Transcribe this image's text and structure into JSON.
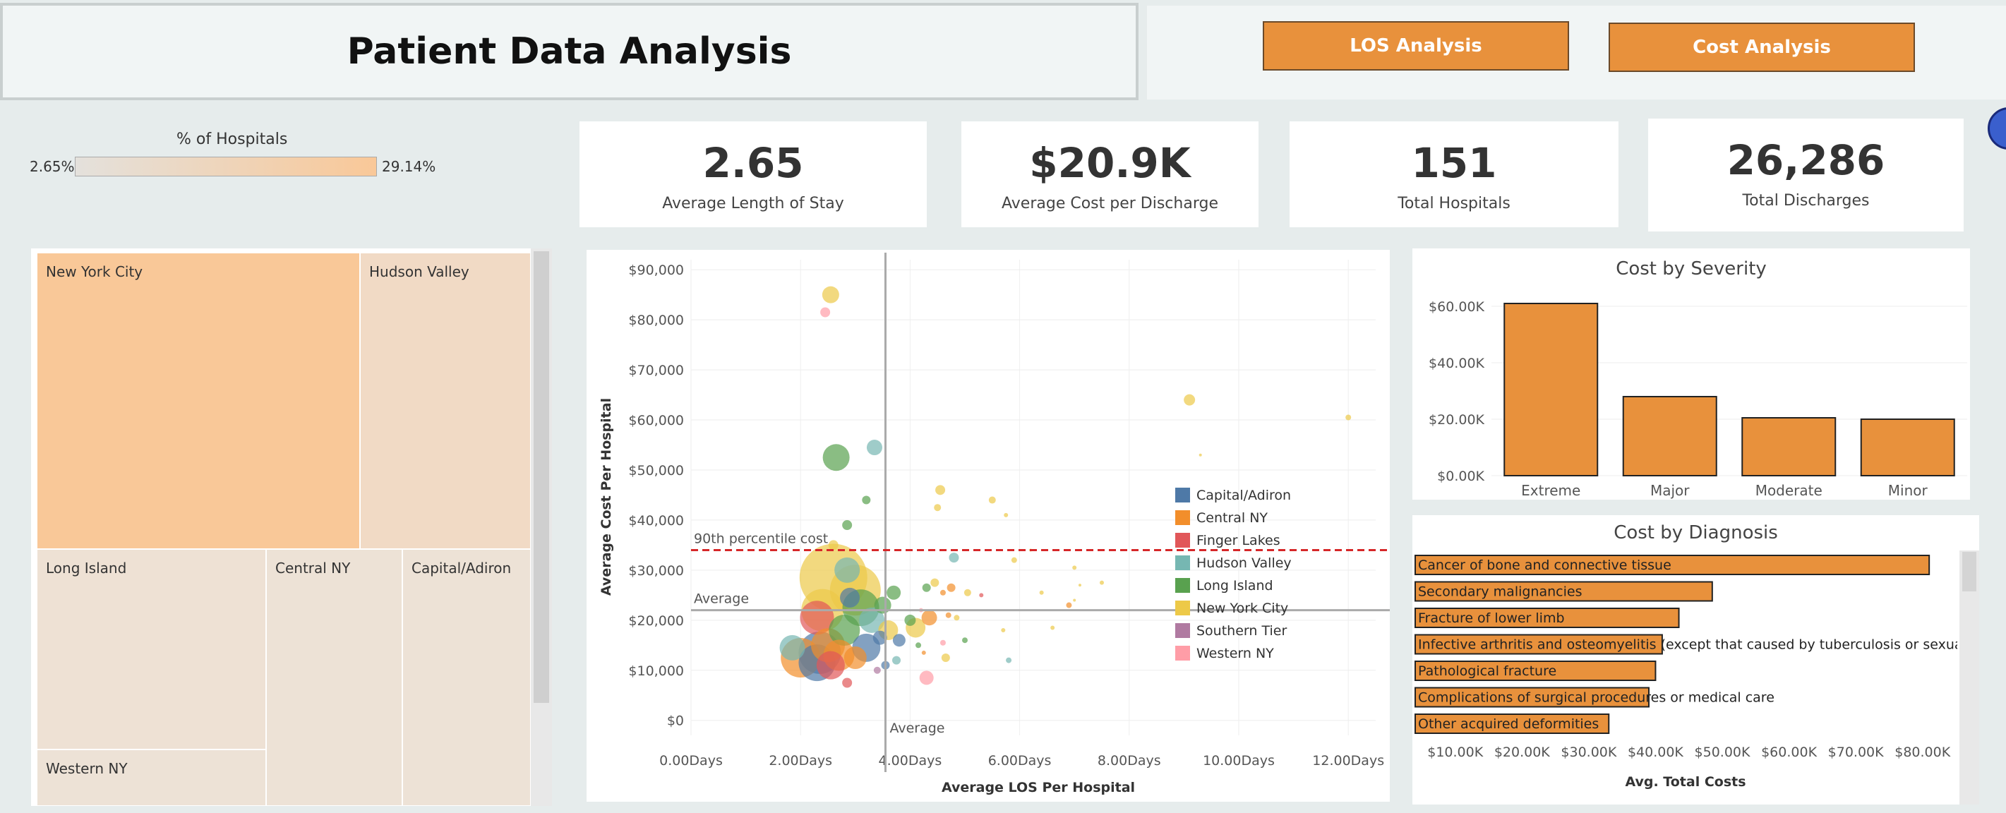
{
  "header": {
    "title": "Patient Data Analysis"
  },
  "nav": {
    "los_button": "LOS Analysis",
    "cost_button": "Cost Analysis"
  },
  "color_legend": {
    "title": "% of Hospitals",
    "min": "2.65%",
    "max": "29.14%"
  },
  "kpis": [
    {
      "value": "2.65",
      "label": "Average Length of Stay"
    },
    {
      "value": "$20.9K",
      "label": "Average Cost per Discharge"
    },
    {
      "value": "151",
      "label": "Total Hospitals"
    },
    {
      "value": "26,286",
      "label": "Total Discharges"
    }
  ],
  "colors": {
    "accent": "#e8913c",
    "background": "#e6ecec",
    "ref_line": "#d62728"
  },
  "chart_data": [
    {
      "type": "treemap",
      "title": "",
      "items": [
        {
          "name": "New York City",
          "color": "#f9c898"
        },
        {
          "name": "Hudson Valley",
          "color": "#f1dac5"
        },
        {
          "name": "Long Island",
          "color": "#eee1d4"
        },
        {
          "name": "Central NY",
          "color": "#ede2d6"
        },
        {
          "name": "Capital/Adiron",
          "color": "#ede2d6"
        },
        {
          "name": "Western NY",
          "color": "#ede2d6"
        }
      ]
    },
    {
      "type": "scatter",
      "title": "",
      "xlabel": "Average LOS Per Hospital",
      "ylabel": "Average Cost Per Hospital",
      "xlim": [
        0,
        12.5
      ],
      "ylim": [
        -3000,
        92000
      ],
      "xticks": [
        "0.00Days",
        "2.00Days",
        "4.00Days",
        "6.00Days",
        "8.00Days",
        "10.00Days",
        "12.00Days"
      ],
      "yticks": [
        "$0",
        "$10,000",
        "$20,000",
        "$30,000",
        "$40,000",
        "$50,000",
        "$60,000",
        "$70,000",
        "$80,000",
        "$90,000"
      ],
      "reference_lines": [
        {
          "label": "Average",
          "axis": "x",
          "value": 3.55
        },
        {
          "label": "Average",
          "axis": "y",
          "value": 22000
        },
        {
          "label": "90th percentile cost",
          "axis": "y",
          "value": 34000
        }
      ],
      "legend": [
        {
          "name": "Capital/Adiron",
          "color": "#4e79a7"
        },
        {
          "name": "Central NY",
          "color": "#f28e2b"
        },
        {
          "name": "Finger Lakes",
          "color": "#e15759"
        },
        {
          "name": "Hudson Valley",
          "color": "#76b7b2"
        },
        {
          "name": "Long Island",
          "color": "#59a14f"
        },
        {
          "name": "New York City",
          "color": "#edc948"
        },
        {
          "name": "Southern Tier",
          "color": "#b07aa1"
        },
        {
          "name": "Western NY",
          "color": "#ff9da7"
        }
      ],
      "points": [
        {
          "x": 2.55,
          "y": 85000,
          "s": 12,
          "c": "New York City"
        },
        {
          "x": 2.45,
          "y": 81500,
          "s": 7,
          "c": "Western NY"
        },
        {
          "x": 9.1,
          "y": 64000,
          "s": 8,
          "c": "New York City"
        },
        {
          "x": 12.0,
          "y": 60500,
          "s": 4,
          "c": "New York City"
        },
        {
          "x": 9.3,
          "y": 53000,
          "s": 2,
          "c": "New York City"
        },
        {
          "x": 2.65,
          "y": 52500,
          "s": 19,
          "c": "Long Island"
        },
        {
          "x": 3.35,
          "y": 54500,
          "s": 11,
          "c": "Hudson Valley"
        },
        {
          "x": 3.2,
          "y": 44000,
          "s": 6,
          "c": "Long Island"
        },
        {
          "x": 2.85,
          "y": 39000,
          "s": 7,
          "c": "Long Island"
        },
        {
          "x": 4.55,
          "y": 46000,
          "s": 7,
          "c": "New York City"
        },
        {
          "x": 4.5,
          "y": 42500,
          "s": 5,
          "c": "New York City"
        },
        {
          "x": 5.5,
          "y": 44000,
          "s": 5,
          "c": "New York City"
        },
        {
          "x": 5.75,
          "y": 41000,
          "s": 3,
          "c": "New York City"
        },
        {
          "x": 2.6,
          "y": 35000,
          "s": 7,
          "c": "New York City"
        },
        {
          "x": 4.8,
          "y": 32500,
          "s": 7,
          "c": "Hudson Valley"
        },
        {
          "x": 5.9,
          "y": 32000,
          "s": 4,
          "c": "New York City"
        },
        {
          "x": 7.0,
          "y": 30500,
          "s": 3,
          "c": "New York City"
        },
        {
          "x": 2.6,
          "y": 28500,
          "s": 48,
          "c": "New York City"
        },
        {
          "x": 3.0,
          "y": 26000,
          "s": 36,
          "c": "New York City"
        },
        {
          "x": 2.4,
          "y": 22000,
          "s": 30,
          "c": "New York City"
        },
        {
          "x": 2.85,
          "y": 30000,
          "s": 18,
          "c": "Hudson Valley"
        },
        {
          "x": 2.3,
          "y": 20500,
          "s": 24,
          "c": "Finger Lakes"
        },
        {
          "x": 3.1,
          "y": 22500,
          "s": 26,
          "c": "Long Island"
        },
        {
          "x": 2.8,
          "y": 18000,
          "s": 22,
          "c": "Long Island"
        },
        {
          "x": 3.3,
          "y": 20000,
          "s": 18,
          "c": "Hudson Valley"
        },
        {
          "x": 2.9,
          "y": 24500,
          "s": 14,
          "c": "Capital/Adiron"
        },
        {
          "x": 3.5,
          "y": 23000,
          "s": 12,
          "c": "Long Island"
        },
        {
          "x": 3.6,
          "y": 18000,
          "s": 14,
          "c": "New York City"
        },
        {
          "x": 3.7,
          "y": 25500,
          "s": 10,
          "c": "Long Island"
        },
        {
          "x": 2.5,
          "y": 15000,
          "s": 24,
          "c": "Central NY"
        },
        {
          "x": 2.7,
          "y": 13000,
          "s": 22,
          "c": "Central NY"
        },
        {
          "x": 2.35,
          "y": 13500,
          "s": 30,
          "c": "Capital/Adiron"
        },
        {
          "x": 2.0,
          "y": 12500,
          "s": 28,
          "c": "Central NY"
        },
        {
          "x": 2.3,
          "y": 11500,
          "s": 26,
          "c": "Capital/Adiron"
        },
        {
          "x": 2.55,
          "y": 11000,
          "s": 20,
          "c": "Finger Lakes"
        },
        {
          "x": 1.85,
          "y": 14500,
          "s": 18,
          "c": "Hudson Valley"
        },
        {
          "x": 3.2,
          "y": 14500,
          "s": 20,
          "c": "Capital/Adiron"
        },
        {
          "x": 3.0,
          "y": 12500,
          "s": 16,
          "c": "Central NY"
        },
        {
          "x": 3.45,
          "y": 16500,
          "s": 10,
          "c": "Capital/Adiron"
        },
        {
          "x": 3.55,
          "y": 11000,
          "s": 6,
          "c": "Capital/Adiron"
        },
        {
          "x": 3.4,
          "y": 10000,
          "s": 5,
          "c": "Southern Tier"
        },
        {
          "x": 2.85,
          "y": 7500,
          "s": 7,
          "c": "Finger Lakes"
        },
        {
          "x": 3.75,
          "y": 12000,
          "s": 6,
          "c": "Hudson Valley"
        },
        {
          "x": 3.8,
          "y": 16000,
          "s": 9,
          "c": "Capital/Adiron"
        },
        {
          "x": 4.3,
          "y": 8500,
          "s": 10,
          "c": "Western NY"
        },
        {
          "x": 4.0,
          "y": 20000,
          "s": 8,
          "c": "Long Island"
        },
        {
          "x": 4.35,
          "y": 20500,
          "s": 11,
          "c": "Central NY"
        },
        {
          "x": 4.1,
          "y": 18500,
          "s": 14,
          "c": "New York City"
        },
        {
          "x": 4.45,
          "y": 27500,
          "s": 6,
          "c": "New York City"
        },
        {
          "x": 4.3,
          "y": 26500,
          "s": 6,
          "c": "Long Island"
        },
        {
          "x": 4.6,
          "y": 25500,
          "s": 4,
          "c": "Central NY"
        },
        {
          "x": 4.7,
          "y": 21000,
          "s": 4,
          "c": "Central NY"
        },
        {
          "x": 4.75,
          "y": 26500,
          "s": 6,
          "c": "Central NY"
        },
        {
          "x": 5.05,
          "y": 25500,
          "s": 5,
          "c": "New York City"
        },
        {
          "x": 5.3,
          "y": 25000,
          "s": 3,
          "c": "Finger Lakes"
        },
        {
          "x": 4.85,
          "y": 20500,
          "s": 4,
          "c": "New York City"
        },
        {
          "x": 4.6,
          "y": 15500,
          "s": 4,
          "c": "Western NY"
        },
        {
          "x": 4.65,
          "y": 12500,
          "s": 6,
          "c": "New York City"
        },
        {
          "x": 5.0,
          "y": 16000,
          "s": 4,
          "c": "Long Island"
        },
        {
          "x": 4.15,
          "y": 15000,
          "s": 4,
          "c": "Long Island"
        },
        {
          "x": 4.2,
          "y": 22000,
          "s": 3,
          "c": "Western NY"
        },
        {
          "x": 4.25,
          "y": 13500,
          "s": 3,
          "c": "Central NY"
        },
        {
          "x": 5.7,
          "y": 18000,
          "s": 3,
          "c": "New York City"
        },
        {
          "x": 5.8,
          "y": 12000,
          "s": 4,
          "c": "Hudson Valley"
        },
        {
          "x": 6.4,
          "y": 25500,
          "s": 3,
          "c": "New York City"
        },
        {
          "x": 6.6,
          "y": 18500,
          "s": 3,
          "c": "New York City"
        },
        {
          "x": 7.5,
          "y": 27500,
          "s": 3,
          "c": "New York City"
        },
        {
          "x": 7.1,
          "y": 27000,
          "s": 2,
          "c": "New York City"
        },
        {
          "x": 7.0,
          "y": 24000,
          "s": 2,
          "c": "New York City"
        },
        {
          "x": 6.9,
          "y": 23000,
          "s": 4,
          "c": "Central NY"
        },
        {
          "x": 6.2,
          "y": 34000,
          "s": 2,
          "c": "New York City"
        }
      ]
    },
    {
      "type": "bar",
      "title": "Cost by Severity",
      "categories": [
        "Extreme",
        "Major",
        "Moderate",
        "Minor"
      ],
      "values": [
        61000,
        28000,
        20500,
        20000
      ],
      "ylim": [
        0,
        65000
      ],
      "yticks": [
        "$0.00K",
        "$20.00K",
        "$40.00K",
        "$60.00K"
      ],
      "color": "#e8913c"
    },
    {
      "type": "bar",
      "orientation": "horizontal",
      "title": "Cost by Diagnosis",
      "xlabel": "Avg. Total Costs",
      "categories": [
        "Cancer of bone and connective tissue",
        "Secondary malignancies",
        "Fracture of lower limb",
        "Infective arthritis and osteomyelitis (except that caused by tuberculosis or sexually tr",
        "Pathological fracture",
        "Complications of surgical procedures or medical care",
        "Other acquired deformities"
      ],
      "values": [
        81000,
        48500,
        43500,
        41000,
        40000,
        39000,
        33000
      ],
      "xlim": [
        4000,
        85000
      ],
      "xticks": [
        "$10.00K",
        "$20.00K",
        "$30.00K",
        "$40.00K",
        "$50.00K",
        "$60.00K",
        "$70.00K",
        "$80.00K"
      ],
      "color": "#e8913c"
    }
  ]
}
